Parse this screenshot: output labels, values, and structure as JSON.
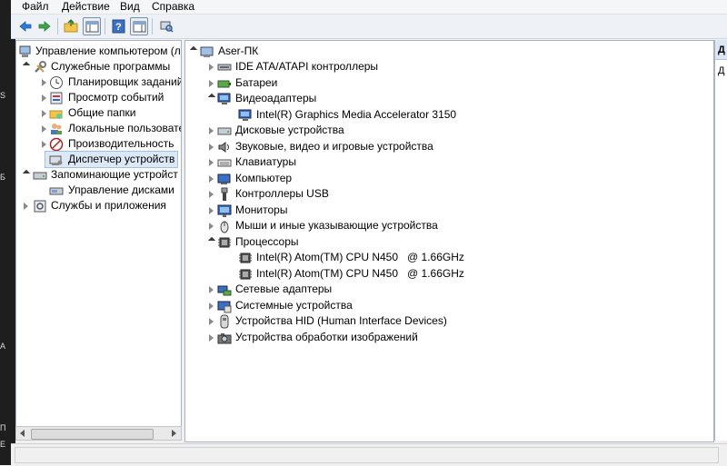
{
  "menu": [
    "Файл",
    "Действие",
    "Вид",
    "Справка"
  ],
  "toolbar": [
    "back-arrow-icon",
    "forward-arrow-icon",
    "up-folder-icon",
    "show-hide-tree-icon",
    "help-icon",
    "action-pane-icon",
    "scan-hardware-icon"
  ],
  "left_tree": {
    "root": "Управление компьютером (л",
    "services": "Служебные программы",
    "scheduler": "Планировщик заданий",
    "events": "Просмотр событий",
    "shared": "Общие папки",
    "localusers": "Локальные пользовате",
    "perf": "Производительность",
    "devmgr": "Диспетчер устройств",
    "storage": "Запоминающие устройст",
    "disks": "Управление дисками",
    "apps": "Службы и приложения"
  },
  "device_tree": {
    "computer": "Aser-ПК",
    "items": [
      {
        "label": "IDE ATA/ATAPI контроллеры",
        "icon": "ide-controller-icon",
        "expanded": false
      },
      {
        "label": "Батареи",
        "icon": "battery-icon",
        "expanded": false
      },
      {
        "label": "Видеоадаптеры",
        "icon": "display-adapter-icon",
        "expanded": true
      },
      {
        "label": "Intel(R) Graphics Media Accelerator 3150",
        "icon": "display-adapter-icon",
        "child": true
      },
      {
        "label": "Дисковые устройства",
        "icon": "disk-drive-icon",
        "expanded": false
      },
      {
        "label": "Звуковые, видео и игровые устройства",
        "icon": "speaker-icon",
        "expanded": false
      },
      {
        "label": "Клавиатуры",
        "icon": "keyboard-icon",
        "expanded": false
      },
      {
        "label": "Компьютер",
        "icon": "computer-icon",
        "expanded": false
      },
      {
        "label": "Контроллеры USB",
        "icon": "usb-icon",
        "expanded": false
      },
      {
        "label": "Мониторы",
        "icon": "monitor-icon",
        "expanded": false
      },
      {
        "label": "Мыши и иные указывающие устройства",
        "icon": "mouse-icon",
        "expanded": false
      },
      {
        "label": "Процессоры",
        "icon": "processor-icon",
        "expanded": true
      },
      {
        "label": "Intel(R) Atom(TM) CPU N450   @ 1.66GHz",
        "icon": "processor-icon",
        "child": true
      },
      {
        "label": "Intel(R) Atom(TM) CPU N450   @ 1.66GHz",
        "icon": "processor-icon",
        "child": true
      },
      {
        "label": "Сетевые адаптеры",
        "icon": "network-adapter-icon",
        "expanded": false
      },
      {
        "label": "Системные устройства",
        "icon": "system-device-icon",
        "expanded": false
      },
      {
        "label": "Устройства HID (Human Interface Devices)",
        "icon": "hid-icon",
        "expanded": false
      },
      {
        "label": "Устройства обработки изображений",
        "icon": "imaging-device-icon",
        "expanded": false
      }
    ]
  },
  "actions_pane": {
    "header": "Д",
    "row": "Д"
  },
  "edge_glyphs": [
    "S",
    "Б",
    "А",
    "П",
    "E"
  ]
}
